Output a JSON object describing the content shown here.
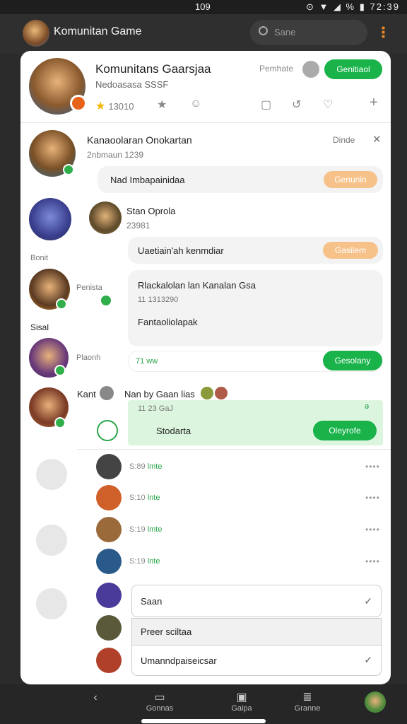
{
  "status": {
    "time_center": "109",
    "right": "⊙ ▼ ◢ % ▮ 72:39"
  },
  "appbar": {
    "title": "Komunitan Game",
    "search_placeholder": "Sane"
  },
  "header": {
    "name": "Komunitans Gaarsjaa",
    "subtitle": "Nedoasasa SSSF",
    "points": "13010",
    "label": "Pemhate",
    "button": "Genitiaol"
  },
  "posts": [
    {
      "name": "Kanaoolaran Onokartan",
      "meta": "2nbmaun  1239",
      "side_label": "Dinde",
      "bubble": "Nad  Imbapainidaa",
      "btn": "Genunin"
    },
    {
      "name": "Stan Oprola",
      "meta": "23981",
      "left_label": "Bonit",
      "bubble": "Uaetiain'ah  kenmdiar",
      "btn": "Gasilem"
    },
    {
      "name": "Rlackalolan lan Kanalan Gsa",
      "meta": "11 1313290",
      "body": "Fantaoliolapak",
      "left_label": "Penista",
      "left_label2": "Sisal"
    },
    {
      "name": "",
      "meta": "71 ww",
      "left_label": "Plaonh",
      "btn": "Gesolany"
    },
    {
      "name": "Kant",
      "name2": "Nan by Gaan lias",
      "meta": "11 23 GaJ",
      "body": "Stodarta",
      "btn": "Oleyrofe",
      "check": "ǝ"
    }
  ],
  "list": [
    {
      "time": "S:89",
      "tag": "lmte"
    },
    {
      "time": "S:10",
      "tag": "lnte"
    },
    {
      "time": "S:19",
      "tag": "lmte"
    },
    {
      "time": "S:19",
      "tag": "lnte"
    }
  ],
  "fields": [
    {
      "value": "Saan"
    },
    {
      "value": "Preer sciltaa"
    },
    {
      "value": "Umanndpaiseicsar"
    }
  ],
  "bottom": {
    "items": [
      "Gonnas",
      "Gaipa",
      "Granne"
    ]
  }
}
